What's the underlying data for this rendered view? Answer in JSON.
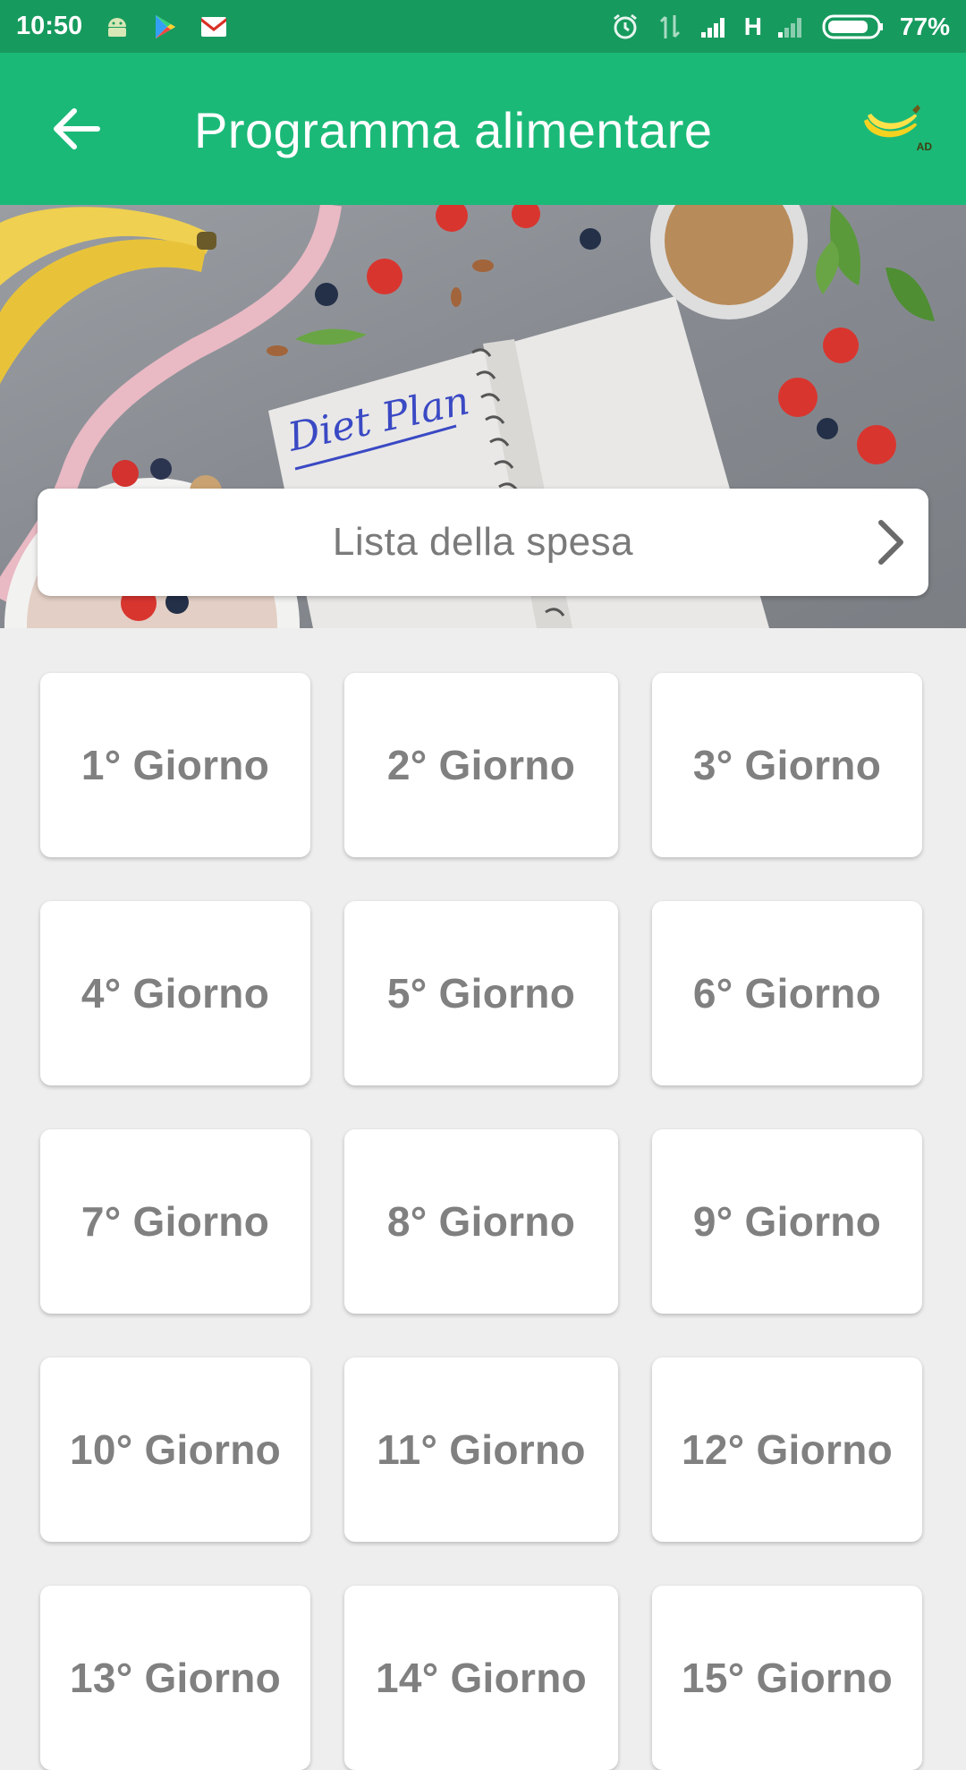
{
  "status_bar": {
    "time": "10:50",
    "network": "H",
    "battery": "77%",
    "icons_left": [
      "android-icon",
      "play-store-icon",
      "gmail-icon"
    ],
    "icons_right": [
      "alarm-icon",
      "data-arrows-icon",
      "signal-icon",
      "signal-icon-2",
      "battery-icon"
    ]
  },
  "app_bar": {
    "title": "Programma alimentare",
    "ad_label": "AD"
  },
  "banner": {
    "notebook_text": "Diet Plan"
  },
  "shopping_list": {
    "label": "Lista della spesa"
  },
  "days": [
    "1° Giorno",
    "2° Giorno",
    "3° Giorno",
    "4° Giorno",
    "5° Giorno",
    "6° Giorno",
    "7° Giorno",
    "8° Giorno",
    "9° Giorno",
    "10° Giorno",
    "11° Giorno",
    "12° Giorno",
    "13° Giorno",
    "14° Giorno",
    "15° Giorno"
  ],
  "colors": {
    "status_bar": "#179a5e",
    "app_bar": "#1bb978",
    "background": "#eeeeee",
    "card": "#ffffff",
    "card_text": "#808080"
  }
}
